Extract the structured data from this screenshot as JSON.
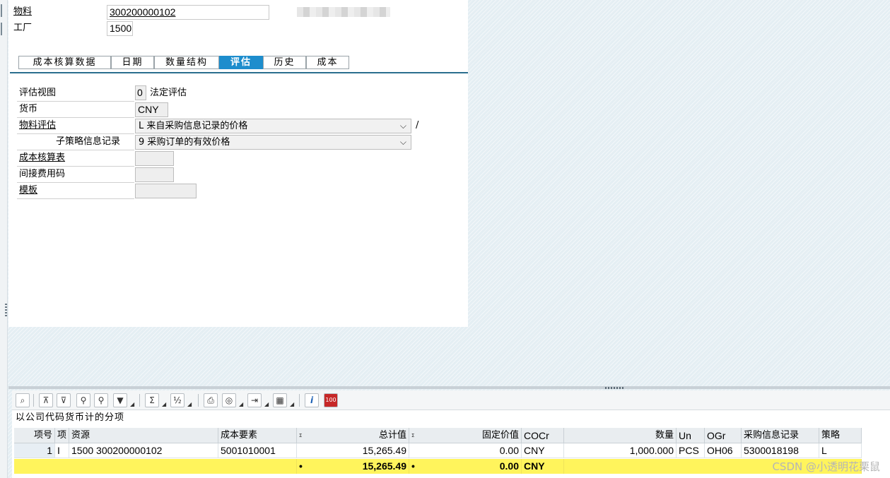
{
  "header": {
    "material_label": "物料",
    "material_value": "300200000102",
    "plant_label": "工厂",
    "plant_value": "1500"
  },
  "tabs": [
    {
      "label": "成本核算数据",
      "active": false
    },
    {
      "label": "日期",
      "active": false
    },
    {
      "label": "数量结构",
      "active": false
    },
    {
      "label": "评估",
      "active": true
    },
    {
      "label": "历史",
      "active": false
    },
    {
      "label": "成本",
      "active": false
    }
  ],
  "valuation": {
    "view_label": "评估视图",
    "view_value": "0",
    "view_text": "法定评估",
    "currency_label": "货币",
    "currency_value": "CNY",
    "material_valuation_label": "物料评估",
    "material_valuation_value": "L 来自采购信息记录的价格",
    "slash": "/",
    "sub_strategy_label": "子策略信息记录",
    "sub_strategy_value": "9 采购订单的有效价格",
    "costing_sheet_label": "成本核算表",
    "overhead_key_label": "间接费用码",
    "template_label": "模板"
  },
  "grid": {
    "title": "以公司代码货币计的分项",
    "toolbar_icons": [
      "details-icon",
      "first-line-icon",
      "last-line-icon",
      "find-icon",
      "find-next-icon",
      "filter-icon",
      "sum-icon",
      "subtotal-icon",
      "print-icon",
      "view-icon",
      "export-icon",
      "layout-icon",
      "info-icon",
      "number-100-icon"
    ],
    "columns": [
      "项号",
      "项",
      "资源",
      "成本要素",
      "总计值",
      "固定价值",
      "COCr",
      "数量",
      "Un",
      "OGr",
      "采购信息记录",
      "策略"
    ],
    "sum_marker": "Σ",
    "rows": [
      {
        "item_no": "1",
        "item_cat": "I",
        "resource": "1500 300200000102",
        "cost_element": "5001010001",
        "total": "15,265.49",
        "fixed": "0.00",
        "cocr": "CNY",
        "qty": "1,000.000",
        "un": "PCS",
        "ogr": "OH06",
        "info_record": "5300018198",
        "strategy": "L"
      }
    ],
    "total_row": {
      "dot1": "•",
      "total": "15,265.49",
      "dot2": "•",
      "fixed": "0.00",
      "cocr": "CNY"
    }
  },
  "watermark": "CSDN @小透明花栗鼠",
  "colors": {
    "active_tab": "#1d8dcd",
    "total_row": "#fff45c",
    "tab_line": "#2b6e8e"
  }
}
